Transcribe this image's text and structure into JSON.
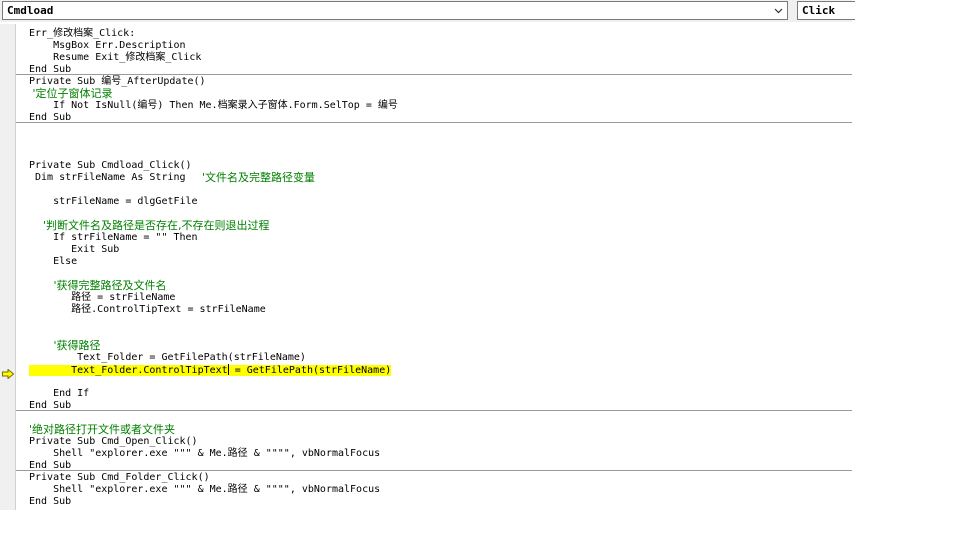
{
  "toolbar": {
    "object_combo_value": "Cmdload",
    "procedure_combo_value": "Click"
  },
  "code": {
    "lines": [
      "Err_修改档案_Click:",
      "    MsgBox Err.Description",
      "    Resume Exit_修改档案_Click",
      "End Sub",
      "Private Sub 编号_AfterUpdate()",
      " '定位子窗体记录",
      "    If Not IsNull(编号) Then Me.档案录入子窗体.Form.SelTop = 编号",
      "End Sub",
      "Private Sub Cmdload_Click()",
      " Dim strFileName As String",
      "'文件名及完整路径变量",
      "    strFileName = dlgGetFile",
      "    '判断文件名及路径是否存在,不存在则退出过程",
      "    If strFileName = \"\" Then",
      "       Exit Sub",
      "    Else",
      "       '获得完整路径及文件名",
      "       路径 = strFileName",
      "       路径.ControlTipText = strFileName",
      "       '获得路径",
      "        Text_Folder = GetFilePath(strFileName)",
      "       Text_Folder.ControlTipText",
      " = GetFilePath(strFileName)",
      "    End If",
      "End Sub",
      "'绝对路径打开文件或者文件夹",
      "Private Sub Cmd_Open_Click()",
      "    Shell \"explorer.exe \"\"\" & Me.路径 & \"\"\"\", vbNormalFocus",
      "End Sub",
      "Private Sub Cmd_Folder_Click()",
      "    Shell \"explorer.exe \"\"\" & Me.路径 & \"\"\"\", vbNormalFocus",
      "End Sub"
    ]
  },
  "colors": {
    "comment": "#008000",
    "highlight": "#ffff00",
    "execution_arrow": "#ffff00"
  },
  "icons": {
    "dropdown": "chevron-down-icon",
    "execution_pointer": "execution-arrow-icon"
  }
}
